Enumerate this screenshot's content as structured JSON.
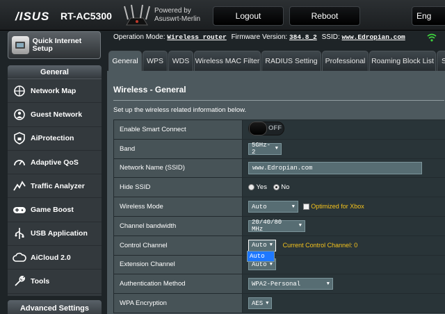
{
  "header": {
    "brand": "/ISUS",
    "model": "RT-AC5300",
    "powered_by": "Powered by",
    "firmware_name": "Asuswrt-Merlin",
    "logout": "Logout",
    "reboot": "Reboot",
    "language": "Eng"
  },
  "sidebar": {
    "quick_setup": "Quick Internet Setup",
    "section": "General",
    "items": [
      {
        "label": "Network Map",
        "icon": "network-map-icon"
      },
      {
        "label": "Guest Network",
        "icon": "guest-network-icon"
      },
      {
        "label": "AiProtection",
        "icon": "shield-lock-icon"
      },
      {
        "label": "Adaptive QoS",
        "icon": "speedometer-icon"
      },
      {
        "label": "Traffic Analyzer",
        "icon": "chart-line-icon"
      },
      {
        "label": "Game Boost",
        "icon": "gamepad-icon"
      },
      {
        "label": "USB Application",
        "icon": "usb-icon"
      },
      {
        "label": "AiCloud 2.0",
        "icon": "cloud-icon"
      },
      {
        "label": "Tools",
        "icon": "wrench-icon"
      }
    ],
    "advanced": "Advanced Settings"
  },
  "status": {
    "mode_label": "Operation Mode:",
    "mode_value": "Wireless router",
    "fw_label": "Firmware Version:",
    "fw_value": "384.8_2",
    "ssid_label": "SSID:",
    "ssid_value": "www.Edropian.com"
  },
  "tabs": [
    {
      "label": "General",
      "active": true
    },
    {
      "label": "WPS"
    },
    {
      "label": "WDS"
    },
    {
      "label": "Wireless MAC Filter"
    },
    {
      "label": "RADIUS Setting"
    },
    {
      "label": "Professional"
    },
    {
      "label": "Roaming Block List"
    },
    {
      "label": "S"
    }
  ],
  "panel": {
    "title": "Wireless - General",
    "description": "Set up the wireless related information below.",
    "rows": {
      "smart_connect": {
        "label": "Enable Smart Connect",
        "state": "OFF"
      },
      "band": {
        "label": "Band",
        "value": "5GHz-2"
      },
      "ssid": {
        "label": "Network Name (SSID)",
        "value": "www.Edropian.com"
      },
      "hide_ssid": {
        "label": "Hide SSID",
        "yes": "Yes",
        "no": "No",
        "selected": "No"
      },
      "wireless_mode": {
        "label": "Wireless Mode",
        "value": "Auto",
        "xbox": "Optimized for Xbox"
      },
      "bandwidth": {
        "label": "Channel bandwidth",
        "value": "20/40/80 MHz"
      },
      "control_channel": {
        "label": "Control Channel",
        "value": "Auto",
        "current": "Current Control Channel: 0",
        "dropdown_option": "Auto"
      },
      "extension_channel": {
        "label": "Extension Channel",
        "value": "Auto"
      },
      "auth_method": {
        "label": "Authentication Method",
        "value": "WPA2-Personal"
      },
      "wpa_encryption": {
        "label": "WPA Encryption",
        "value": "AES"
      }
    }
  },
  "colors": {
    "panel": "#4d595e",
    "accent_note": "#f5c31c",
    "dropdown_highlight": "#1e78ff"
  }
}
